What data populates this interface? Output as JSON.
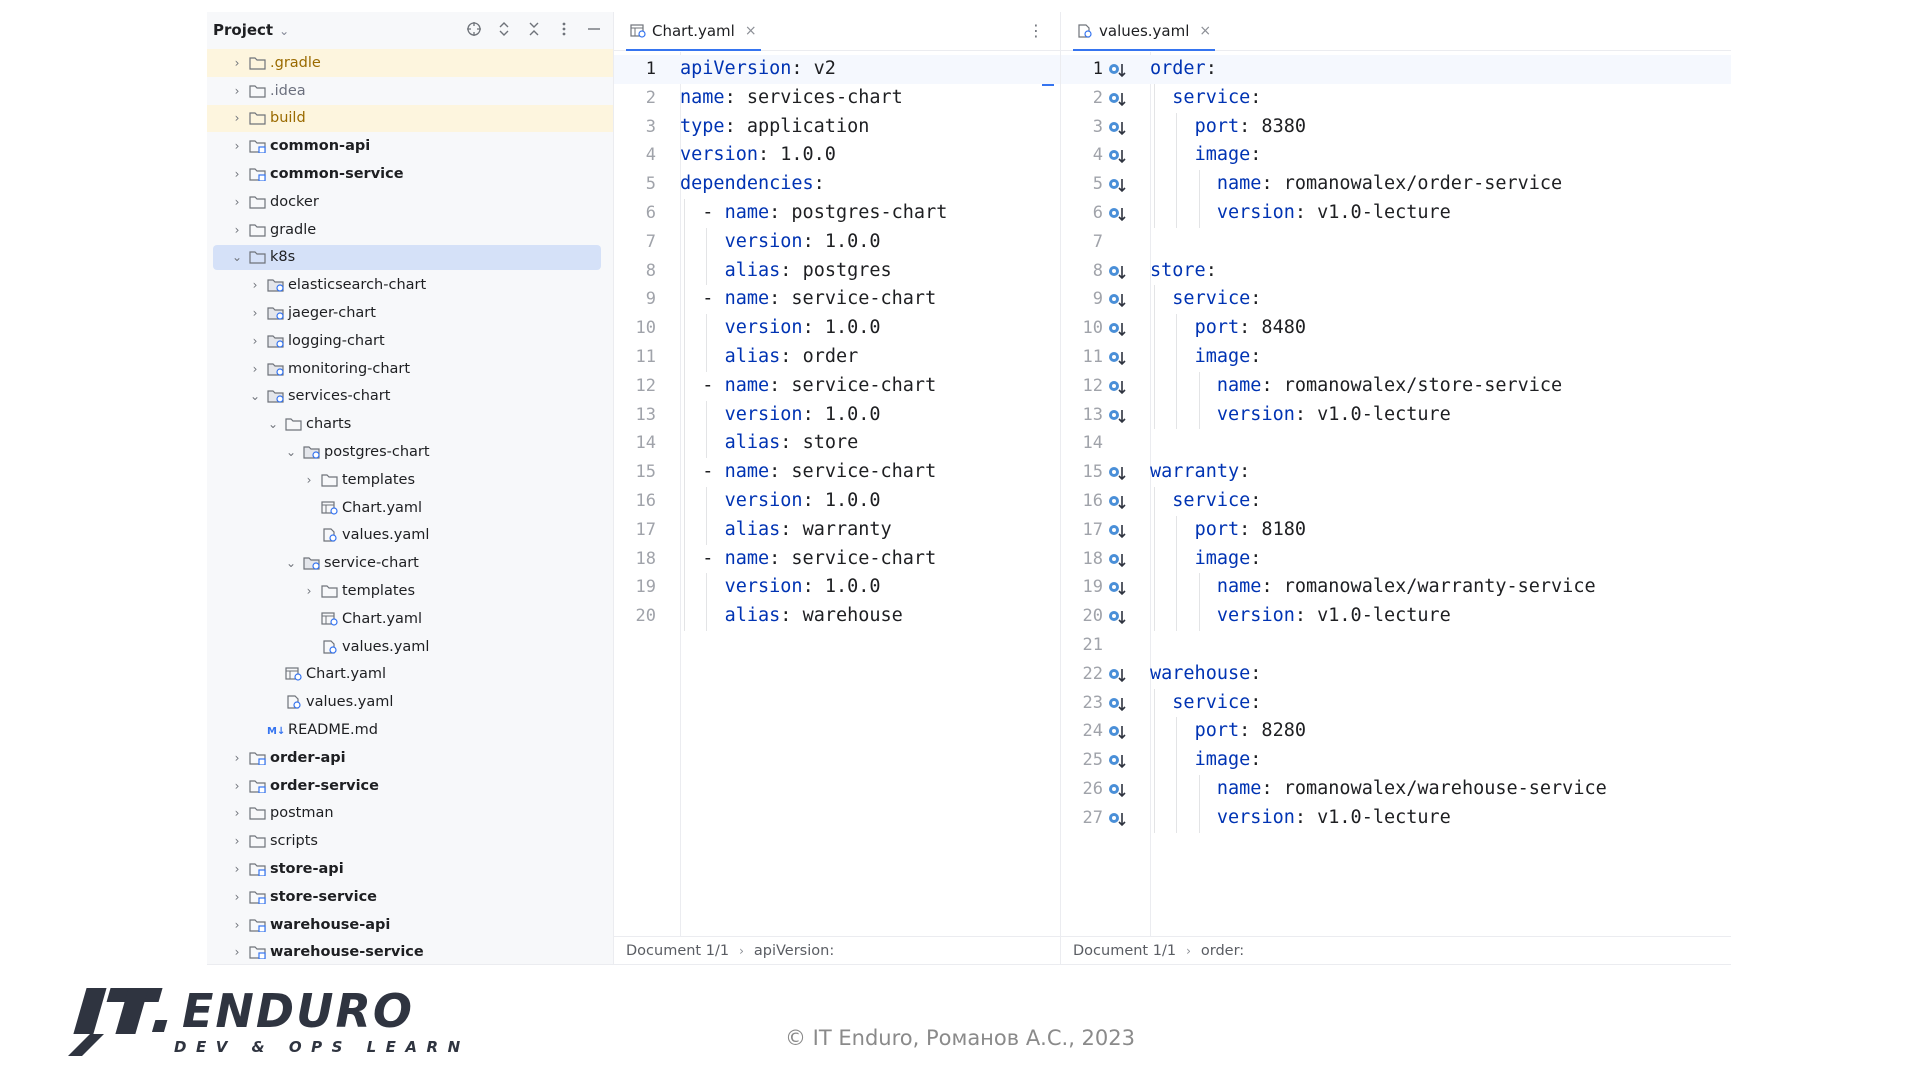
{
  "project": {
    "title": "Project",
    "tree": [
      {
        "label": ".gradle",
        "depth": 0,
        "expanded": false,
        "icon": "folder-icon",
        "style": "orange",
        "excluded": true
      },
      {
        "label": ".idea",
        "depth": 0,
        "expanded": false,
        "icon": "folder-icon",
        "style": "muted"
      },
      {
        "label": "build",
        "depth": 0,
        "expanded": false,
        "icon": "folder-icon",
        "style": "orange",
        "excluded": true
      },
      {
        "label": "common-api",
        "depth": 0,
        "expanded": false,
        "icon": "module-folder-icon",
        "style": "bold"
      },
      {
        "label": "common-service",
        "depth": 0,
        "expanded": false,
        "icon": "module-folder-icon",
        "style": "bold"
      },
      {
        "label": "docker",
        "depth": 0,
        "expanded": false,
        "icon": "folder-icon",
        "style": ""
      },
      {
        "label": "gradle",
        "depth": 0,
        "expanded": false,
        "icon": "folder-icon",
        "style": ""
      },
      {
        "label": "k8s",
        "depth": 0,
        "expanded": true,
        "icon": "folder-icon",
        "style": "",
        "selected": true
      },
      {
        "label": "elasticsearch-chart",
        "depth": 1,
        "expanded": false,
        "icon": "helm-chart-folder-icon",
        "style": ""
      },
      {
        "label": "jaeger-chart",
        "depth": 1,
        "expanded": false,
        "icon": "helm-chart-folder-icon",
        "style": ""
      },
      {
        "label": "logging-chart",
        "depth": 1,
        "expanded": false,
        "icon": "helm-chart-folder-icon",
        "style": ""
      },
      {
        "label": "monitoring-chart",
        "depth": 1,
        "expanded": false,
        "icon": "helm-chart-folder-icon",
        "style": ""
      },
      {
        "label": "services-chart",
        "depth": 1,
        "expanded": true,
        "icon": "helm-chart-folder-icon",
        "style": ""
      },
      {
        "label": "charts",
        "depth": 2,
        "expanded": true,
        "icon": "folder-icon",
        "style": ""
      },
      {
        "label": "postgres-chart",
        "depth": 3,
        "expanded": true,
        "icon": "helm-chart-folder-icon",
        "style": ""
      },
      {
        "label": "templates",
        "depth": 4,
        "expanded": false,
        "icon": "folder-icon",
        "style": ""
      },
      {
        "label": "Chart.yaml",
        "depth": 4,
        "expanded": null,
        "icon": "chart-yaml-file-icon",
        "style": ""
      },
      {
        "label": "values.yaml",
        "depth": 4,
        "expanded": null,
        "icon": "values-yaml-file-icon",
        "style": ""
      },
      {
        "label": "service-chart",
        "depth": 3,
        "expanded": true,
        "icon": "helm-chart-folder-icon",
        "style": ""
      },
      {
        "label": "templates",
        "depth": 4,
        "expanded": false,
        "icon": "folder-icon",
        "style": ""
      },
      {
        "label": "Chart.yaml",
        "depth": 4,
        "expanded": null,
        "icon": "chart-yaml-file-icon",
        "style": ""
      },
      {
        "label": "values.yaml",
        "depth": 4,
        "expanded": null,
        "icon": "values-yaml-file-icon",
        "style": ""
      },
      {
        "label": "Chart.yaml",
        "depth": 2,
        "expanded": null,
        "icon": "chart-yaml-file-icon",
        "style": ""
      },
      {
        "label": "values.yaml",
        "depth": 2,
        "expanded": null,
        "icon": "values-yaml-file-icon",
        "style": ""
      },
      {
        "label": "README.md",
        "depth": 1,
        "expanded": null,
        "icon": "markdown-file-icon",
        "style": ""
      },
      {
        "label": "order-api",
        "depth": 0,
        "expanded": false,
        "icon": "module-folder-icon",
        "style": "bold"
      },
      {
        "label": "order-service",
        "depth": 0,
        "expanded": false,
        "icon": "module-folder-icon",
        "style": "bold"
      },
      {
        "label": "postman",
        "depth": 0,
        "expanded": false,
        "icon": "folder-icon",
        "style": ""
      },
      {
        "label": "scripts",
        "depth": 0,
        "expanded": false,
        "icon": "folder-icon",
        "style": ""
      },
      {
        "label": "store-api",
        "depth": 0,
        "expanded": false,
        "icon": "module-folder-icon",
        "style": "bold"
      },
      {
        "label": "store-service",
        "depth": 0,
        "expanded": false,
        "icon": "module-folder-icon",
        "style": "bold"
      },
      {
        "label": "warehouse-api",
        "depth": 0,
        "expanded": false,
        "icon": "module-folder-icon",
        "style": "bold"
      },
      {
        "label": "warehouse-service",
        "depth": 0,
        "expanded": false,
        "icon": "module-folder-icon",
        "style": "bold"
      }
    ]
  },
  "left_editor": {
    "tab_label": "Chart.yaml",
    "lines": [
      {
        "num": "1",
        "indent": 0,
        "key": "apiVersion",
        "value": " v2"
      },
      {
        "num": "2",
        "indent": 0,
        "key": "name",
        "value": " services-chart"
      },
      {
        "num": "3",
        "indent": 0,
        "key": "type",
        "value": " application"
      },
      {
        "num": "4",
        "indent": 0,
        "key": "version",
        "value": " 1.0.0"
      },
      {
        "num": "5",
        "indent": 0,
        "key": "dependencies",
        "value": ""
      },
      {
        "num": "6",
        "indent": 1,
        "prefix": "- ",
        "key": "name",
        "value": " postgres-chart"
      },
      {
        "num": "7",
        "indent": 2,
        "key": "version",
        "value": " 1.0.0"
      },
      {
        "num": "8",
        "indent": 2,
        "key": "alias",
        "value": " postgres"
      },
      {
        "num": "9",
        "indent": 1,
        "prefix": "- ",
        "key": "name",
        "value": " service-chart"
      },
      {
        "num": "10",
        "indent": 2,
        "key": "version",
        "value": " 1.0.0"
      },
      {
        "num": "11",
        "indent": 2,
        "key": "alias",
        "value": " order"
      },
      {
        "num": "12",
        "indent": 1,
        "prefix": "- ",
        "key": "name",
        "value": " service-chart"
      },
      {
        "num": "13",
        "indent": 2,
        "key": "version",
        "value": " 1.0.0"
      },
      {
        "num": "14",
        "indent": 2,
        "key": "alias",
        "value": " store"
      },
      {
        "num": "15",
        "indent": 1,
        "prefix": "- ",
        "key": "name",
        "value": " service-chart"
      },
      {
        "num": "16",
        "indent": 2,
        "key": "version",
        "value": " 1.0.0"
      },
      {
        "num": "17",
        "indent": 2,
        "key": "alias",
        "value": " warranty"
      },
      {
        "num": "18",
        "indent": 1,
        "prefix": "- ",
        "key": "name",
        "value": " service-chart"
      },
      {
        "num": "19",
        "indent": 2,
        "key": "version",
        "value": " 1.0.0"
      },
      {
        "num": "20",
        "indent": 2,
        "key": "alias",
        "value": " warehouse"
      }
    ],
    "status": {
      "document": "Document 1/1",
      "path": "apiVersion:"
    }
  },
  "right_editor": {
    "tab_label": "values.yaml",
    "lines": [
      {
        "num": "1",
        "indent": 0,
        "key": "order",
        "value": "",
        "override": true
      },
      {
        "num": "2",
        "indent": 1,
        "key": "service",
        "value": "",
        "override": true
      },
      {
        "num": "3",
        "indent": 2,
        "key": "port",
        "value": " 8380",
        "override": true
      },
      {
        "num": "4",
        "indent": 2,
        "key": "image",
        "value": "",
        "override": true
      },
      {
        "num": "5",
        "indent": 3,
        "key": "name",
        "value": " romanowalex/order-service",
        "override": true
      },
      {
        "num": "6",
        "indent": 3,
        "key": "version",
        "value": " v1.0-lecture",
        "override": true
      },
      {
        "num": "7",
        "indent": 0,
        "key": "",
        "value": "",
        "override": false
      },
      {
        "num": "8",
        "indent": 0,
        "key": "store",
        "value": "",
        "override": true
      },
      {
        "num": "9",
        "indent": 1,
        "key": "service",
        "value": "",
        "override": true
      },
      {
        "num": "10",
        "indent": 2,
        "key": "port",
        "value": " 8480",
        "override": true
      },
      {
        "num": "11",
        "indent": 2,
        "key": "image",
        "value": "",
        "override": true
      },
      {
        "num": "12",
        "indent": 3,
        "key": "name",
        "value": " romanowalex/store-service",
        "override": true
      },
      {
        "num": "13",
        "indent": 3,
        "key": "version",
        "value": " v1.0-lecture",
        "override": true
      },
      {
        "num": "14",
        "indent": 0,
        "key": "",
        "value": "",
        "override": false
      },
      {
        "num": "15",
        "indent": 0,
        "key": "warranty",
        "value": "",
        "override": true
      },
      {
        "num": "16",
        "indent": 1,
        "key": "service",
        "value": "",
        "override": true
      },
      {
        "num": "17",
        "indent": 2,
        "key": "port",
        "value": " 8180",
        "override": true
      },
      {
        "num": "18",
        "indent": 2,
        "key": "image",
        "value": "",
        "override": true
      },
      {
        "num": "19",
        "indent": 3,
        "key": "name",
        "value": " romanowalex/warranty-service",
        "override": true
      },
      {
        "num": "20",
        "indent": 3,
        "key": "version",
        "value": " v1.0-lecture",
        "override": true
      },
      {
        "num": "21",
        "indent": 0,
        "key": "",
        "value": "",
        "override": false
      },
      {
        "num": "22",
        "indent": 0,
        "key": "warehouse",
        "value": "",
        "override": true
      },
      {
        "num": "23",
        "indent": 1,
        "key": "service",
        "value": "",
        "override": true
      },
      {
        "num": "24",
        "indent": 2,
        "key": "port",
        "value": " 8280",
        "override": true
      },
      {
        "num": "25",
        "indent": 2,
        "key": "image",
        "value": "",
        "override": true
      },
      {
        "num": "26",
        "indent": 3,
        "key": "name",
        "value": " romanowalex/warehouse-service",
        "override": true
      },
      {
        "num": "27",
        "indent": 3,
        "key": "version",
        "value": " v1.0-lecture",
        "override": true
      }
    ],
    "status": {
      "document": "Document 1/1",
      "path": "order:"
    }
  },
  "footer": {
    "logo_text": "IT ENDURO",
    "logo_tagline": "DEV & OPS LEARNING",
    "copyright": "© IT Enduro, Романов А.С., 2023"
  },
  "colors": {
    "key": "#0033b3",
    "accent": "#3574f0",
    "selection": "#d5e1f8",
    "excluded_bg": "#fdf5de",
    "logo": "#2f3440"
  }
}
